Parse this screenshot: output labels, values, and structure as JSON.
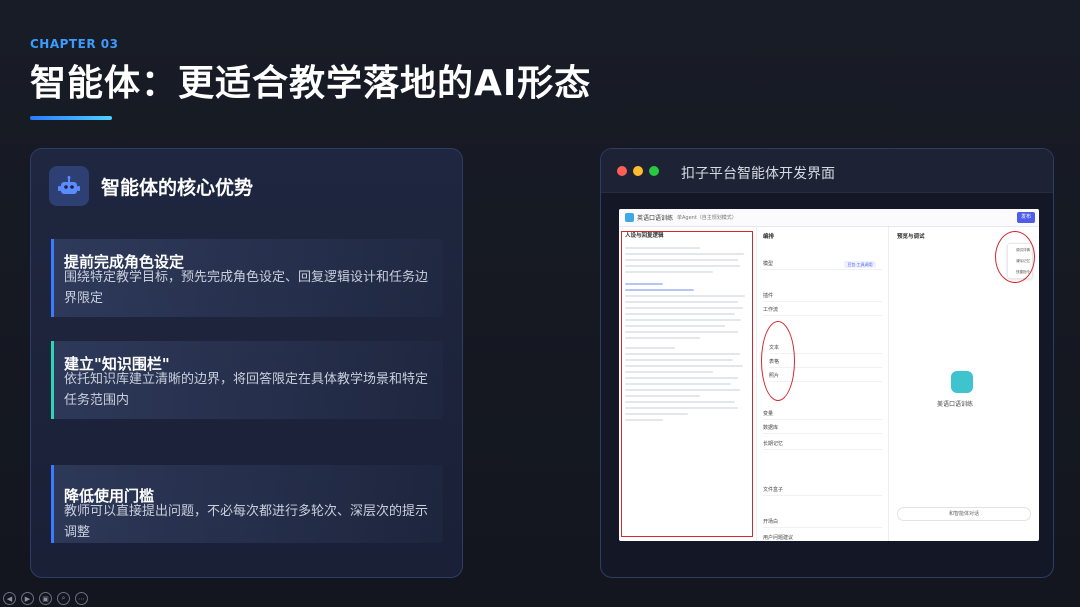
{
  "header": {
    "chapter": "CHAPTER 03",
    "title": "智能体：更适合教学落地的AI形态"
  },
  "left_card": {
    "title": "智能体的核心优势",
    "icon": "robot-icon",
    "items": [
      {
        "heading": "提前完成角色设定",
        "desc": "围绕特定教学目标，预先完成角色设定、回复逻辑设计和任务边界限定",
        "accent": "#3b7bff"
      },
      {
        "heading": "建立\"知识围栏\"",
        "desc": "依托知识库建立清晰的边界，将回答限定在具体教学场景和特定任务范围内",
        "accent": "#2fd4b0"
      },
      {
        "heading": "降低使用门槛",
        "desc": "教师可以直接提出问题，不必每次都进行多轮次、深层次的提示调整",
        "accent": "#3b7bff"
      }
    ]
  },
  "window": {
    "title": "扣子平台智能体开发界面",
    "dots": [
      "#ff5f57",
      "#febc2e",
      "#28c840"
    ],
    "screenshot": {
      "app_name": "英语口语训练",
      "agent_label": "单Agent（自主规划模式）",
      "publish": "发布",
      "col1_title": "人设与回复逻辑",
      "col2_title": "编排",
      "col2_rows": [
        "模型",
        "插件",
        "工作流",
        "文本",
        "表格",
        "照片",
        "变量",
        "数据库",
        "长期记忆",
        "文件盒子",
        "开场白",
        "用户问题建议"
      ],
      "col2_chip": "豆包·工具调用",
      "col3_title": "预览与调试",
      "bot_name": "美语口语训练",
      "input_placeholder": "和智能体对话",
      "menu_items": [
        "调试详情",
        "清除记忆",
        "快捷指令"
      ]
    }
  },
  "toolbar": [
    "◀",
    "▶",
    "▣",
    "⌕",
    "⋯"
  ]
}
